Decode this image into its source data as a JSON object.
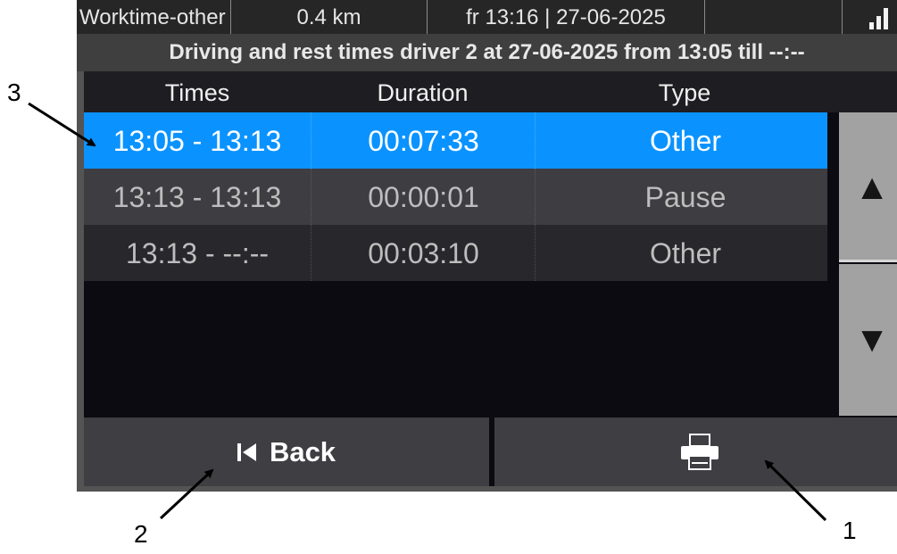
{
  "status_bar": {
    "mode": "Worktime-other",
    "distance": "0.4 km",
    "datetime": "fr 13:16 | 27-06-2025",
    "signal_icon": "signal-bars-icon"
  },
  "title": "Driving and rest times driver 2 at 27-06-2025 from 13:05 till --:--",
  "table": {
    "headers": {
      "times": "Times",
      "duration": "Duration",
      "type": "Type"
    },
    "rows": [
      {
        "times": "13:05 - 13:13",
        "duration": "00:07:33",
        "type": "Other"
      },
      {
        "times": "13:13 - 13:13",
        "duration": "00:00:01",
        "type": "Pause"
      },
      {
        "times": "13:13 - --:--",
        "duration": "00:03:10",
        "type": "Other"
      }
    ],
    "selected_row": 0
  },
  "scroll": {
    "up_icon": "▲",
    "down_icon": "▼"
  },
  "buttons": {
    "back_label": "Back",
    "back_icon": "back-to-start-icon",
    "print_icon": "printer-icon"
  },
  "callouts": {
    "one": "1",
    "two": "2",
    "three": "3"
  },
  "colors": {
    "selected_row": "#0a93ff",
    "scroll_buttons": "#a2a2a2",
    "background": "#0b0b11"
  }
}
